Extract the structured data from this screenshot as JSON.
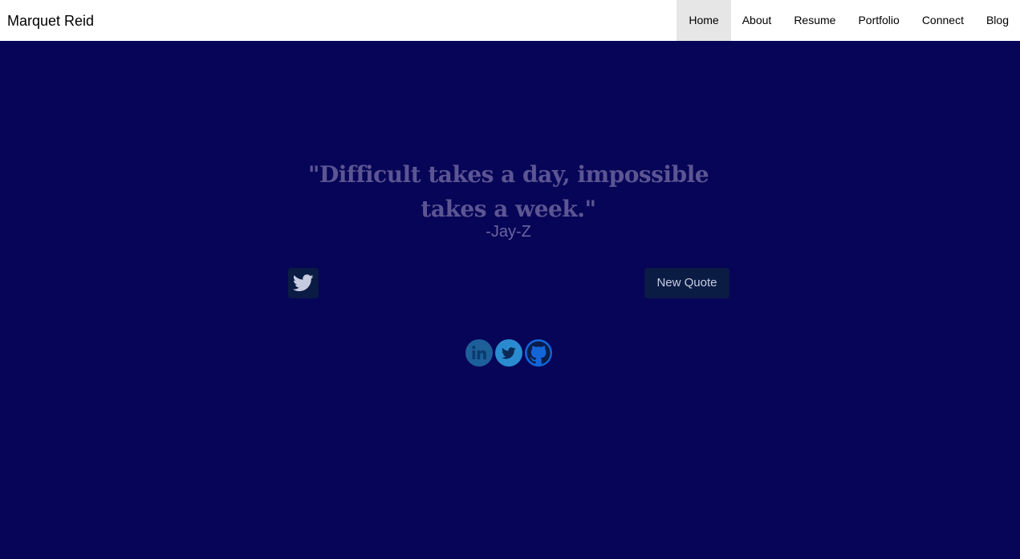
{
  "brand": "Marquet Reid",
  "nav": {
    "items": [
      "Home",
      "About",
      "Resume",
      "Portfolio",
      "Connect",
      "Blog"
    ],
    "active": "Home"
  },
  "quote": {
    "text": "\"Difficult takes a day, impossible takes a week.\"",
    "author": "-Jay-Z"
  },
  "buttons": {
    "tweet_icon": "twitter-icon",
    "new_quote": "New Quote"
  },
  "social": [
    "linkedin-icon",
    "twitter-icon",
    "github-icon"
  ],
  "colors": {
    "background": "#070557",
    "navbar": "#ffffff",
    "quote": "#5c5593",
    "button": "#0a1b44"
  }
}
